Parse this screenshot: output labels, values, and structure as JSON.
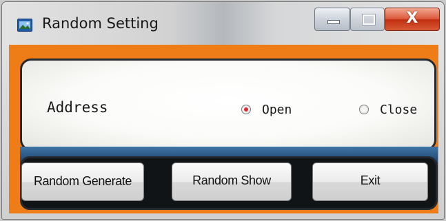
{
  "window": {
    "title": "Random Setting",
    "icon": "app-window-icon",
    "controls": {
      "minimize": "minimize-icon",
      "maximize": "maximize-icon",
      "close_glyph": "X"
    }
  },
  "form": {
    "address_label": "Address",
    "options": [
      {
        "label": "Open",
        "selected": true
      },
      {
        "label": "Close",
        "selected": false
      }
    ]
  },
  "buttons": {
    "random": "Random Generate",
    "random_show": "Random Show",
    "exit": "Exit"
  },
  "colors": {
    "frame_accent": "#ee7d18",
    "radio_selected": "#e0262e",
    "panel_border": "#24292f"
  }
}
